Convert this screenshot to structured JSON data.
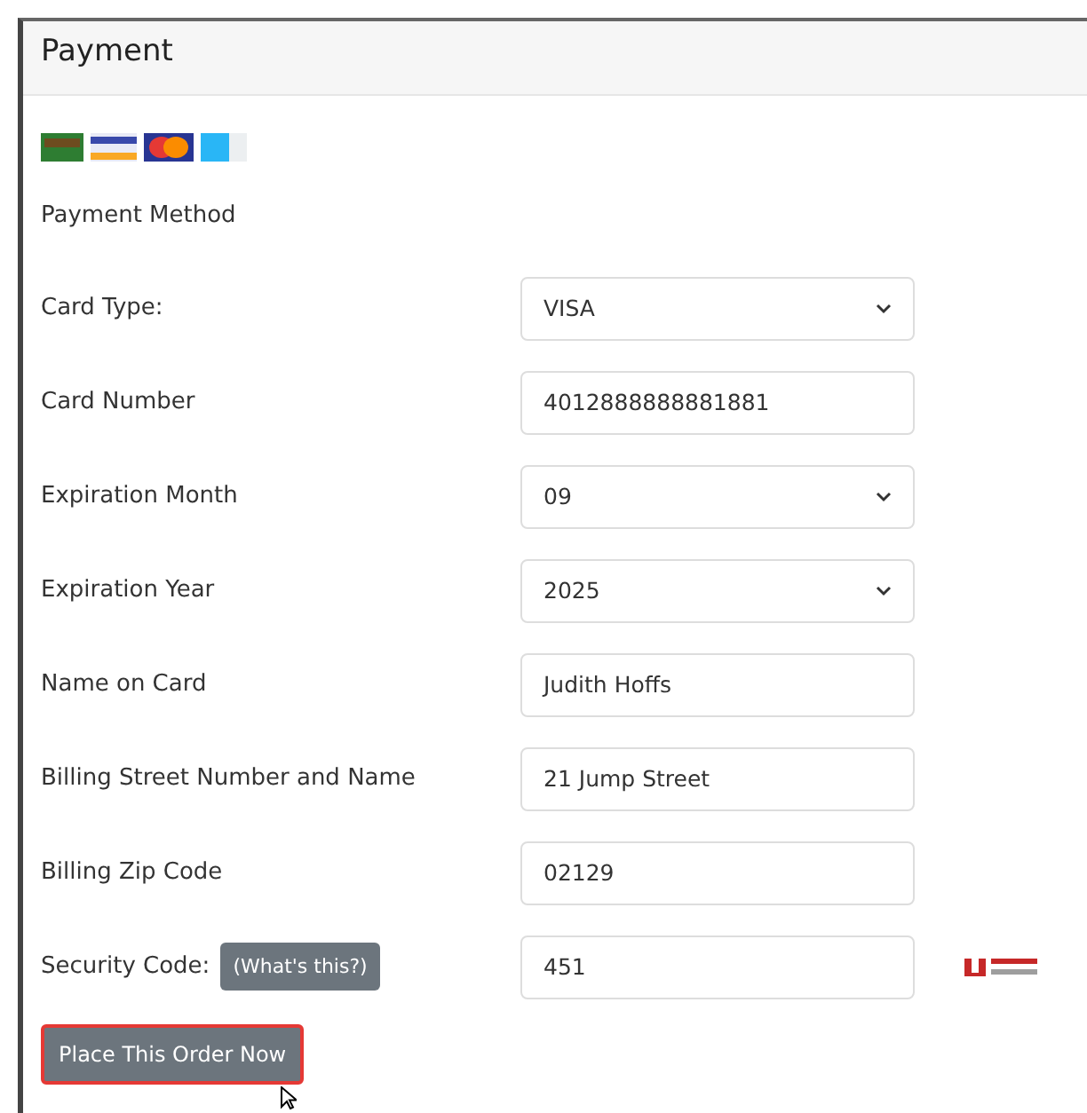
{
  "panel": {
    "title": "Payment"
  },
  "section_label": "Payment Method",
  "fields": [
    {
      "label": "Card Type:",
      "kind": "select",
      "value": "VISA"
    },
    {
      "label": "Card Number",
      "kind": "input",
      "value": "4012888888881881"
    },
    {
      "label": "Expiration Month",
      "kind": "select",
      "value": "09"
    },
    {
      "label": "Expiration Year",
      "kind": "select",
      "value": "2025"
    },
    {
      "label": "Name on Card",
      "kind": "input",
      "value": "Judith Hoffs"
    },
    {
      "label": "Billing Street Number and Name",
      "kind": "input",
      "value": "21 Jump Street"
    },
    {
      "label": "Billing Zip Code",
      "kind": "input",
      "value": "02129"
    },
    {
      "label": "Security Code:",
      "kind": "input",
      "value": "451",
      "help": "(What's this?)"
    }
  ],
  "submit_button": "Place This Order Now"
}
